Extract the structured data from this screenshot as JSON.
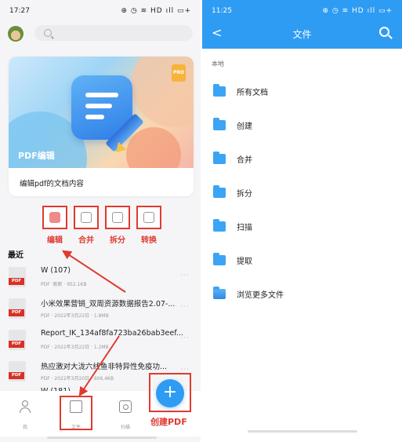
{
  "left_screen": {
    "status_bar": {
      "time": "17:27",
      "icons": "⊕ ◷ ≋ HD ıll ▭+"
    },
    "card": {
      "badge": "PRO",
      "banner_title": "PDF编辑",
      "description": "编辑pdf的文档内容"
    },
    "tools": [
      {
        "label": "编辑",
        "icon": "edit-icon"
      },
      {
        "label": "合并",
        "icon": "merge-icon"
      },
      {
        "label": "拆分",
        "icon": "split-icon"
      },
      {
        "label": "转换",
        "icon": "convert-icon"
      }
    ],
    "recent": {
      "title": "最近",
      "files": [
        {
          "name": "W (107)",
          "meta": "PDF ·刚刚 · 952.1KB"
        },
        {
          "name": "小米效果营销_双周资源数据报告2.07-...",
          "meta": "PDF · 2022年3月22日 · 1.8MB"
        },
        {
          "name": "Report_IK_134af8fa723ba26bab3eef...",
          "meta": "PDF · 2022年3月22日 · 1.2MB"
        },
        {
          "name": "热应激对大泷六线鱼非特异性免疫功...",
          "meta": "PDF · 2022年3月20日 · 606.4KB"
        },
        {
          "name": "W (181)",
          "meta": ""
        }
      ]
    },
    "bottom_nav": [
      {
        "label": "我"
      },
      {
        "label": "文件"
      },
      {
        "label": "扫描"
      }
    ],
    "fab": {
      "symbol": "+",
      "annotation": "创建PDF"
    },
    "annotation_color": "#e03a2f"
  },
  "right_screen": {
    "status_bar": {
      "time": "11:25",
      "icons": "⊕ ◷ ≋ HD ıll ▭+"
    },
    "header": {
      "back": "<",
      "title": "文件"
    },
    "section_label": "本地",
    "folders": [
      {
        "label": "所有文档"
      },
      {
        "label": "创建"
      },
      {
        "label": "合并"
      },
      {
        "label": "拆分"
      },
      {
        "label": "扫描"
      },
      {
        "label": "提取"
      },
      {
        "label": "浏览更多文件"
      }
    ],
    "accent_color": "#2f9cf3"
  }
}
